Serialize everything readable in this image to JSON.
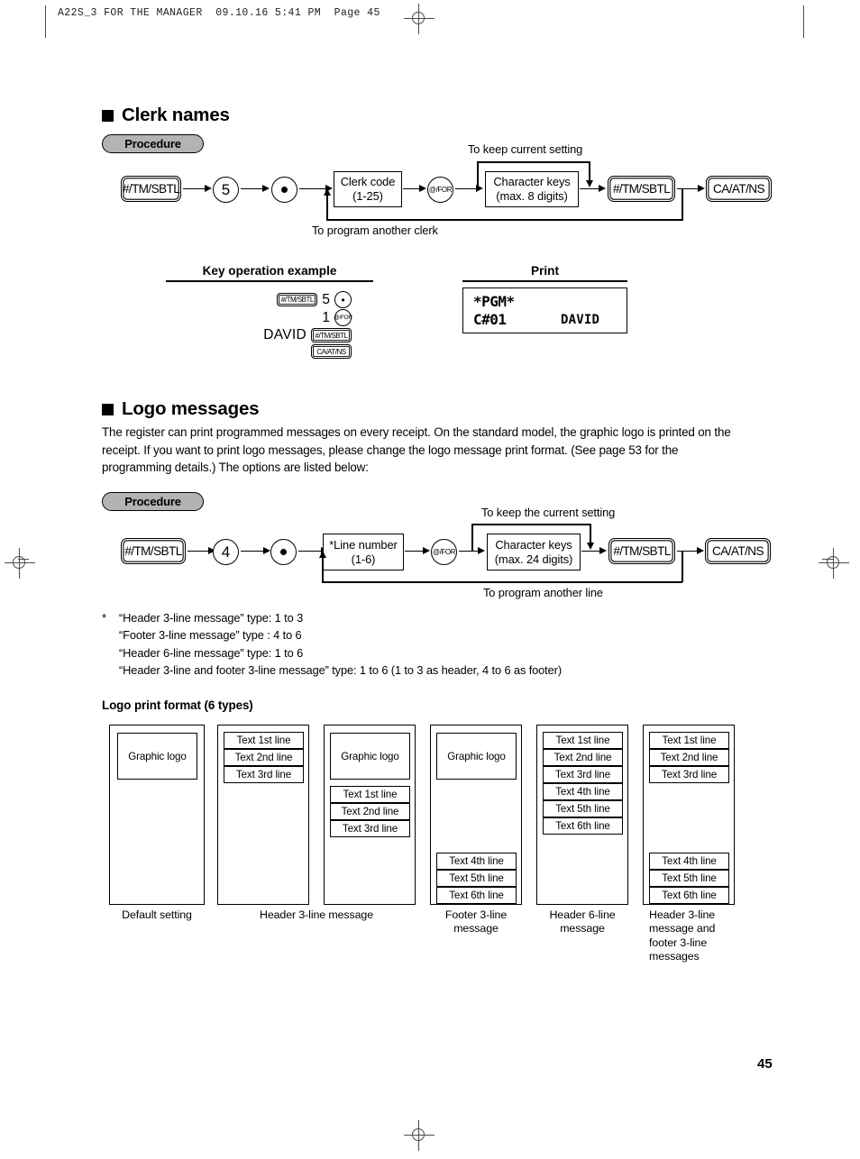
{
  "page": {
    "header_line": "A22S_3 FOR THE MANAGER  09.10.16 5:41 PM  Page 45",
    "page_number": "45"
  },
  "section_clerk": {
    "title": "Clerk names",
    "procedure_label": "Procedure",
    "flow": {
      "k1": "#/TM/SBTL",
      "k2": "5",
      "k3": "•",
      "box_code_l1": "Clerk code",
      "box_code_l2": "(1-25)",
      "k4": "@/FOR",
      "box_chars_l1": "Character keys",
      "box_chars_l2": "(max. 8 digits)",
      "k5": "#/TM/SBTL",
      "k6": "CA/AT/NS",
      "label_keep": "To keep current setting",
      "label_another": "To program another clerk"
    },
    "example_head": "Key operation example",
    "print_head": "Print",
    "example": {
      "r1_key": "#/TM/SBTL",
      "r1_num": "5",
      "r1_dot": "•",
      "r2_num": "1",
      "r2_key": "@/FOR",
      "r3_word": "DAVID",
      "r3_key": "#/TM/SBTL",
      "r4_key": "CA/AT/NS"
    },
    "receipt": {
      "line1": "*PGM*",
      "line2_left": "C#01",
      "line2_right": "DAVID"
    }
  },
  "section_logo": {
    "title": "Logo messages",
    "paragraph": "The register can print programmed messages on every receipt. On the standard model, the graphic logo is printed on the receipt.  If you want to print logo messages, please change the logo message print format. (See page 53 for the programming details.)  The options are listed below:",
    "procedure_label": "Procedure",
    "flow": {
      "k1": "#/TM/SBTL",
      "k2": "4",
      "k3": "•",
      "box_line_l1": "*Line number",
      "box_line_l2": "(1-6)",
      "k4": "@/FOR",
      "box_chars_l1": "Character keys",
      "box_chars_l2": "(max. 24 digits)",
      "k5": "#/TM/SBTL",
      "k6": "CA/AT/NS",
      "label_keep": "To keep the current setting",
      "label_another": "To program another line"
    },
    "notes_star": "*",
    "notes": [
      "“Header 3-line message” type: 1 to 3",
      "“Footer 3-line message” type  : 4 to 6",
      "“Header 6-line message” type: 1 to 6",
      "“Header 3-line and footer 3-line message” type: 1 to 6 (1 to 3 as header, 4 to 6 as footer)"
    ],
    "format_head": "Logo print format (6 types)",
    "labels": {
      "graphic_logo": "Graphic logo",
      "t1": "Text 1st line",
      "t2": "Text 2nd line",
      "t3": "Text 3rd line",
      "t4": "Text 4th line",
      "t5": "Text 5th line",
      "t6": "Text 6th line"
    },
    "captions": {
      "c1": "Default setting",
      "c23": "Header 3-line message",
      "c4": "Footer 3-line message",
      "c5": "Header 6-line message",
      "c6": "Header 3-line message and footer 3-line messages"
    }
  }
}
